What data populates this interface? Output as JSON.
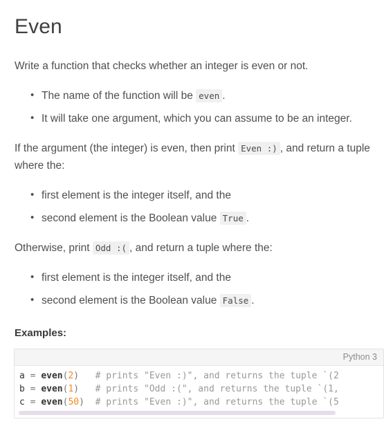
{
  "page": {
    "title": "Even",
    "intro": "Write a function that checks whether an integer is even or not.",
    "examples_heading": "Examples:"
  },
  "list_one": {
    "item1_before": "The name of the function will be ",
    "item1_code": "even",
    "item1_after": ".",
    "item2": "It will take one argument, which you can assume to be an integer."
  },
  "para_even": {
    "before": "If the argument (the integer) is even, then print ",
    "code": "Even :)",
    "after": ", and return a tuple where the:"
  },
  "list_two": {
    "item1": "first element is the integer itself, and the",
    "item2_before": "second element is the Boolean value ",
    "item2_code": "True",
    "item2_after": "."
  },
  "para_odd": {
    "before": "Otherwise, print ",
    "code": "Odd :(",
    "after": ", and return a tuple where the:"
  },
  "list_three": {
    "item1": "first element is the integer itself, and the",
    "item2_before": "second element is the Boolean value ",
    "item2_code": "False",
    "item2_after": "."
  },
  "codeblock": {
    "language_label": "Python 3",
    "lines": [
      {
        "var": "a",
        "op": " = ",
        "fn": "even",
        "open": "(",
        "num": "2",
        "close": ")",
        "gap": "   ",
        "comment": "# prints \"Even :)\", and returns the tuple `(2"
      },
      {
        "var": "b",
        "op": " = ",
        "fn": "even",
        "open": "(",
        "num": "1",
        "close": ")",
        "gap": "   ",
        "comment": "# prints \"Odd :(\", and returns the tuple `(1,"
      },
      {
        "var": "c",
        "op": " = ",
        "fn": "even",
        "open": "(",
        "num": "50",
        "close": ")",
        "gap": "  ",
        "comment": "# prints \"Even :)\", and returns the tuple `(5"
      }
    ]
  },
  "colors": {
    "number_literal": "#f5871f",
    "comment": "#999999",
    "inline_code_bg": "#f0f0f0",
    "header_bg": "#f5f5f5",
    "scrollbar_thumb": "#e6dcea"
  }
}
